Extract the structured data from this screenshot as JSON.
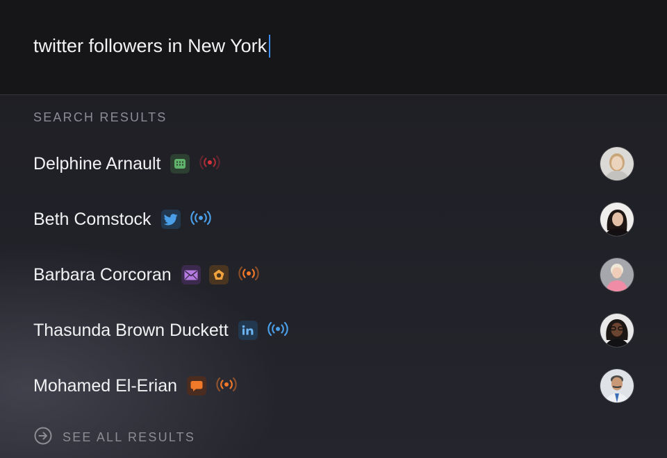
{
  "search": {
    "query": "twitter followers in New York"
  },
  "results_section": {
    "label": "SEARCH RESULTS"
  },
  "results": [
    {
      "name": "Delphine Arnault",
      "badges": [
        {
          "icon": "calendar-icon",
          "color": "#5fb36b"
        }
      ],
      "signal": {
        "icon": "broadcast-signal-icon",
        "color": "#d9323c"
      },
      "avatar": {
        "icon": "avatar-photo",
        "color": "#c8c4bd"
      }
    },
    {
      "name": "Beth Comstock",
      "badges": [
        {
          "icon": "twitter-bird-icon",
          "color": "#4a9fe8"
        }
      ],
      "signal": {
        "icon": "broadcast-signal-icon",
        "color": "#4a9fe8"
      },
      "avatar": {
        "icon": "avatar-photo",
        "color": "#e8e6e3"
      }
    },
    {
      "name": "Barbara Corcoran",
      "badges": [
        {
          "icon": "envelope-icon",
          "color": "#b57be0"
        },
        {
          "icon": "pentagon-icon",
          "color": "#f0a33c"
        }
      ],
      "signal": {
        "icon": "broadcast-signal-icon",
        "color": "#f07a2a"
      },
      "avatar": {
        "icon": "avatar-photo",
        "color": "#9ea0a6"
      }
    },
    {
      "name": "Thasunda Brown Duckett",
      "badges": [
        {
          "icon": "linkedin-icon",
          "color": "#4a9fe8"
        }
      ],
      "signal": {
        "icon": "broadcast-signal-icon",
        "color": "#4a9fe8"
      },
      "avatar": {
        "icon": "avatar-photo",
        "color": "#e5e5e5"
      }
    },
    {
      "name": "Mohamed El-Erian",
      "badges": [
        {
          "icon": "chat-bubble-icon",
          "color": "#f07a2a"
        }
      ],
      "signal": {
        "icon": "broadcast-signal-icon",
        "color": "#f07a2a"
      },
      "avatar": {
        "icon": "avatar-photo",
        "color": "#d5d8de"
      }
    }
  ],
  "footer": {
    "see_all_label": "SEE ALL RESULTS",
    "see_all_icon": "arrow-circle-right-icon"
  }
}
